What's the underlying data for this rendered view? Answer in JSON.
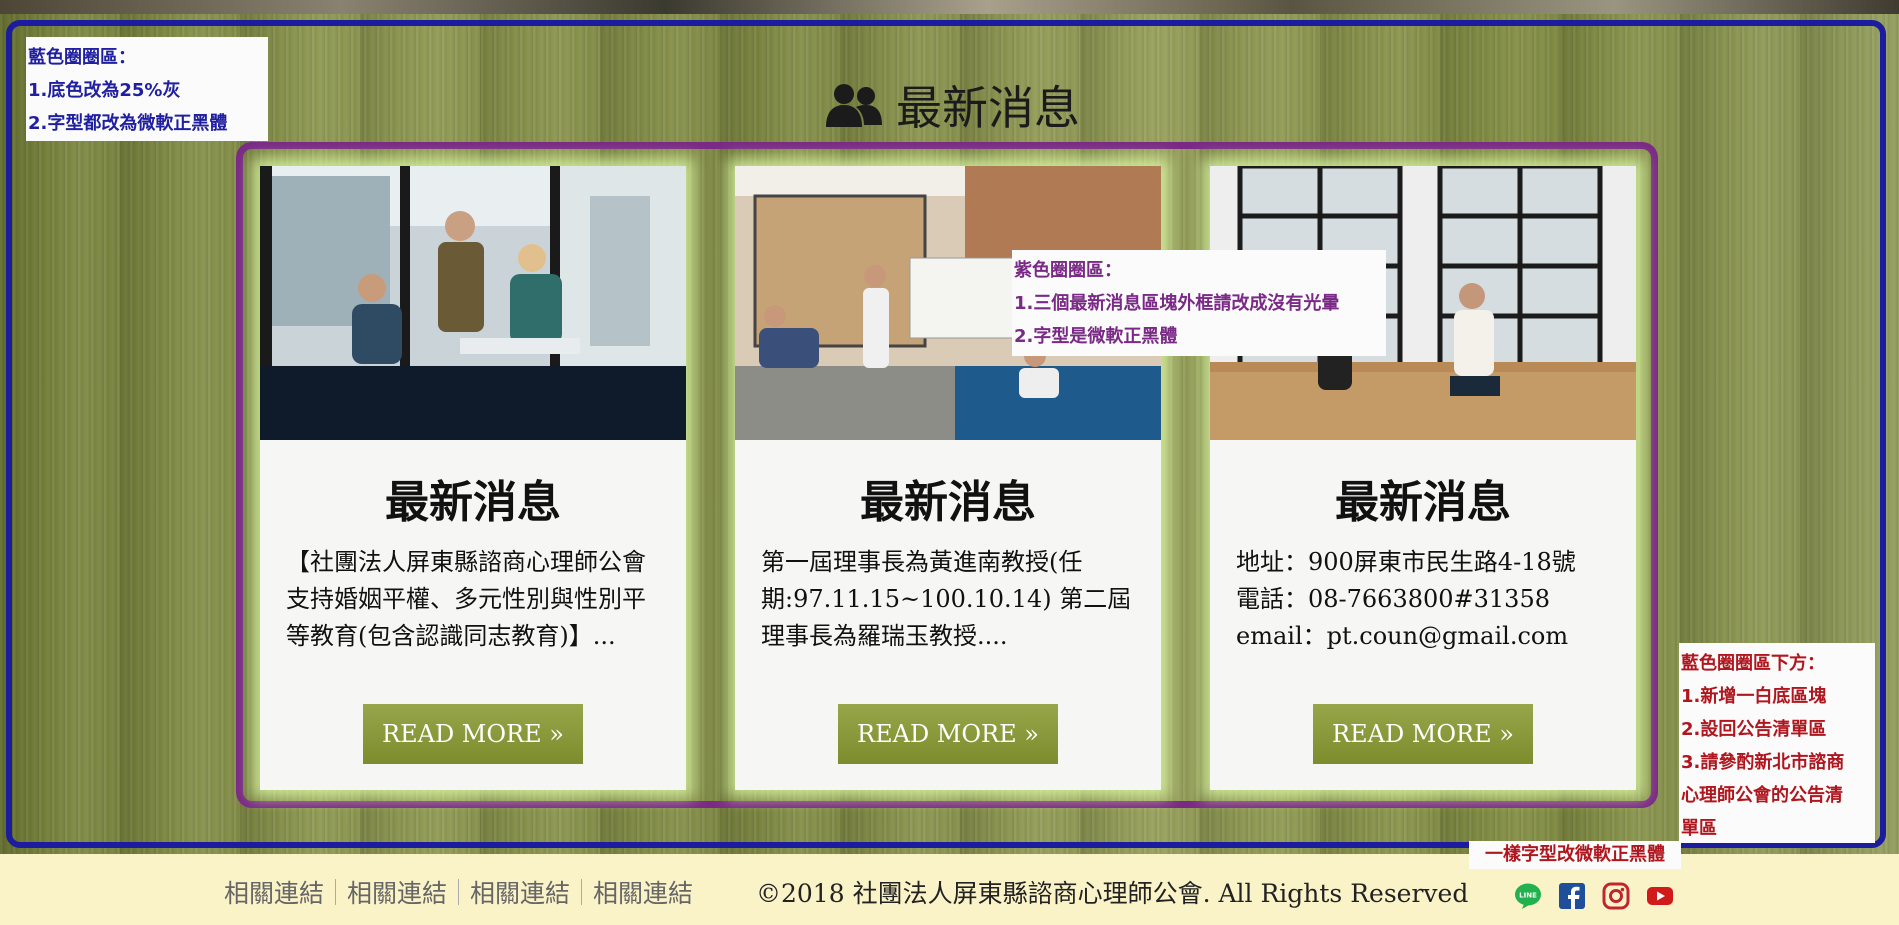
{
  "section": {
    "title": "最新消息",
    "title_icon": "users-icon"
  },
  "cards": [
    {
      "title": "最新消息",
      "text": "【社團法人屏東縣諮商心理師公會支持婚姻平權、多元性別與性別平等教育(包含認識同志教育)】...",
      "button": "READ MORE »"
    },
    {
      "title": "最新消息",
      "text": "第一屆理事長為黃進南教授(任期:97.11.15~100.10.14) 第二屆理事長為羅瑞玉教授....",
      "button": "READ MORE »"
    },
    {
      "title": "最新消息",
      "text": "地址：900屏東市民生路4-18號\n電話：08-7663800#31358\nemail：pt.coun@gmail.com",
      "button": "READ MORE »"
    }
  ],
  "notes": {
    "blue": {
      "line1": "藍色圈圈區：",
      "line2": "1.底色改為25%灰",
      "line3": "2.字型都改為微軟正黑體"
    },
    "purple": {
      "line1": "紫色圈圈區：",
      "line2": "1.三個最新消息區塊外框請改成沒有光暈",
      "line3": "2.字型是微軟正黑體"
    },
    "red": {
      "line1": "藍色圈圈區下方：",
      "line2": "1.新增一白底區塊",
      "line3": "2.設回公告清單區",
      "line4": "3.請參酌新北市諮商",
      "line5": "心理師公會的公告清",
      "line6": "單區"
    },
    "red_footer": "一樣字型改微軟正黑體"
  },
  "footer": {
    "links": [
      "相關連結",
      "相關連結",
      "相關連結",
      "相關連結"
    ],
    "copyright": "©2018 社團法人屏東縣諮商心理師公會. All Rights Reserved",
    "social": [
      "line-icon",
      "facebook-icon",
      "instagram-icon",
      "youtube-icon"
    ]
  },
  "colors": {
    "blue_frame": "#1c1c9e",
    "purple_frame": "#7a2a86",
    "button": "#8a9a3a",
    "footer_bg": "#fbf3c8",
    "note_red": "#b0161e"
  }
}
